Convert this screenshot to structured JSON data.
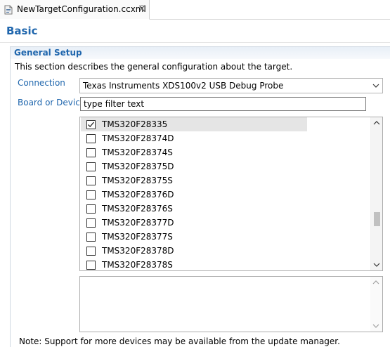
{
  "tab": {
    "label": "NewTargetConfiguration.ccxml",
    "icon": "ccxml-file-icon",
    "close_icon": "close-icon"
  },
  "page": {
    "title": "Basic"
  },
  "section": {
    "title": "General Setup",
    "description": "This section describes the general configuration about the target."
  },
  "connection": {
    "label": "Connection",
    "value": "Texas Instruments XDS100v2 USB Debug Probe"
  },
  "board": {
    "label": "Board or Device",
    "filter_value": "type filter text"
  },
  "devices": [
    {
      "name": "TMS320F28335",
      "checked": true
    },
    {
      "name": "TMS320F28374D",
      "checked": false
    },
    {
      "name": "TMS320F28374S",
      "checked": false
    },
    {
      "name": "TMS320F28375D",
      "checked": false
    },
    {
      "name": "TMS320F28375S",
      "checked": false
    },
    {
      "name": "TMS320F28376D",
      "checked": false
    },
    {
      "name": "TMS320F28376S",
      "checked": false
    },
    {
      "name": "TMS320F28377D",
      "checked": false
    },
    {
      "name": "TMS320F28377S",
      "checked": false
    },
    {
      "name": "TMS320F28378D",
      "checked": false
    },
    {
      "name": "TMS320F28378S",
      "checked": false
    }
  ],
  "note": "Note: Support for more devices may be available from the update manager.",
  "colors": {
    "accent": "#1f66ad",
    "selected_row": "#e5e5e5"
  }
}
